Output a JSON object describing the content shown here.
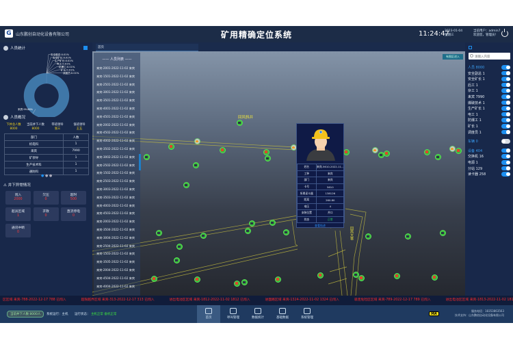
{
  "header": {
    "company": "山东鹏创自动化设备有限公司",
    "title": "矿用精确定位系统",
    "time": "11:24:47",
    "date": "2023-01-04",
    "weekday": "星期三",
    "user": "当前用户：admin7",
    "welcome": "欢迎您，管理员！"
  },
  "left": {
    "stats_title": "人员统计",
    "pie": {
      "labels": [
        "安全副总:0.01%",
        "安全矿长:0.01%",
        "生产矿长:0.01%",
        "电工:0.01%",
        "防爆工:0.01%",
        "矿长:0.01%",
        "调度员:0.01%",
        "来宾:99.88%"
      ],
      "values": [
        0.01,
        0.01,
        0.01,
        0.01,
        0.01,
        0.01,
        0.01,
        99.88
      ],
      "color": "#3f77a8"
    },
    "overview_title": "人员概况",
    "overview": [
      {
        "label": "下井总人数",
        "value": "8000"
      },
      {
        "label": "当前井下人数",
        "value": "8000"
      },
      {
        "label": "带班领导",
        "value": "张三"
      },
      {
        "label": "值班领导",
        "value": "王五"
      }
    ],
    "dept_headers": [
      "部门",
      "人数"
    ],
    "depts": [
      [
        "机电科",
        "1"
      ],
      [
        "来宾",
        "7990"
      ],
      [
        "矿领导",
        "1"
      ],
      [
        "生产技术科",
        "1"
      ],
      [
        "通防科",
        "1"
      ]
    ],
    "alarm_title": "井下异常情况",
    "alarms": [
      {
        "label": "闯入",
        "value": "2000"
      },
      {
        "label": "欠压",
        "value": "0"
      },
      {
        "label": "超时",
        "value": "500"
      },
      {
        "label": "超员区域",
        "value": "1"
      },
      {
        "label": "求救",
        "value": "0"
      },
      {
        "label": "直流停电",
        "value": "0"
      },
      {
        "label": "通讯中断",
        "value": "0"
      }
    ]
  },
  "tab": "首页",
  "map": {
    "button": "有限区进入",
    "list_title": "人员列表",
    "list": [
      "来宾-2001-2022-11-02 来宾",
      "来宾-1501-2022-11-02 来宾",
      "来宾-2501-2022-11-02 来宾",
      "来宾-3001-2022-11-02 来宾",
      "来宾-3501-2022-11-02 来宾",
      "来宾-4001-2022-11-02 来宾",
      "来宾-4501-2022-11-02 来宾",
      "来宾-2002-2022-11-02 来宾",
      "来宾-4502-2022-11-02 来宾",
      "来宾-4002-2022-11-02 来宾",
      "来宾-3502-2022-11-02 来宾",
      "来宾-3002-2022-11-02 来宾",
      "来宾-2502-2022-11-02 来宾",
      "来宾-1502-2022-11-02 来宾",
      "来宾-2503-2022-11-02 来宾",
      "来宾-3003-2022-11-02 来宾",
      "来宾-3503-2022-11-02 来宾",
      "来宾-4003-2022-11-02 来宾",
      "来宾-4503-2022-11-02 来宾",
      "来宾-2003-2022-11-02 来宾",
      "来宾-3504-2022-11-02 来宾",
      "来宾-3004-2022-11-02 来宾",
      "来宾-2504-2022-11-02 来宾",
      "来宾-1503-2022-11-02 来宾",
      "来宾-3505-2022-11-02 来宾",
      "来宾-2004-2022-11-02 来宾",
      "来宾-4504-2022-11-02 来宾",
      "来宾-4004-2022-11-02 来宾"
    ],
    "labels": {
      "tunnel1": "回风斜井",
      "tunnel2": "回风大巷"
    },
    "tunnel_color": "#c8c040",
    "popup": {
      "rows": [
        [
          "姓名",
          "来宾-5610-2022-11..."
        ],
        [
          "工种",
          "来宾"
        ],
        [
          "部门",
          "来宾"
        ],
        [
          "卡号",
          "5610"
        ],
        [
          "所属读卡器",
          "138126"
        ],
        [
          "距离",
          "260.80"
        ],
        [
          "电压",
          "4"
        ],
        [
          "安装位置",
          "井口"
        ],
        [
          "状态",
          "正常"
        ]
      ],
      "footer": "查看轨迹"
    }
  },
  "right": {
    "search_placeholder": "请输入内容",
    "groups": [
      {
        "title": "人员 8000",
        "on": true,
        "items": [
          {
            "label": "安全副总  1",
            "on": true
          },
          {
            "label": "安全矿长  1",
            "on": true
          },
          {
            "label": "后工  1",
            "on": true
          },
          {
            "label": "杂工  1",
            "on": true
          },
          {
            "label": "来宾  7990",
            "on": true
          },
          {
            "label": "爆破技术  1",
            "on": true
          },
          {
            "label": "生产矿长  1",
            "on": true
          },
          {
            "label": "电工  1",
            "on": true
          },
          {
            "label": "防爆工  1",
            "on": true
          },
          {
            "label": "矿长  1",
            "on": true
          },
          {
            "label": "调度员  1",
            "on": true
          }
        ]
      },
      {
        "title": "车辆 0",
        "on": false,
        "items": []
      },
      {
        "title": "设备 404",
        "on": true,
        "items": [
          {
            "label": "交换机  16",
            "on": true
          },
          {
            "label": "电源  1",
            "on": true
          },
          {
            "label": "分站  129",
            "on": true
          },
          {
            "label": "读卡器  258",
            "on": true
          }
        ]
      }
    ]
  },
  "ticker": [
    "区区域 来宾-788-2022-12-17 788 已闯入",
    "超限越界区域 来宾-313-2022-12-17 313 已闯入",
    "进出电池区区域 来宾-1812-2022-11-02 1812 已闯入",
    "进面路区域 来宾-1324-2022-11-02 1324 已闯入",
    "吸连危险区区域 来宾-789-2022-12-17 789 已闯入",
    "进出电池区区域 来宾-1813-2022-11-02 1813 已闯入"
  ],
  "footer": {
    "badge": "当前井下人数 8000人",
    "system_label": "系统运行：",
    "system_value": "主机",
    "status_label": "运行状态：",
    "status_value": "主机正常 备机正常",
    "nav": [
      "首页",
      "呼叫管理",
      "数据统计",
      "基础数据",
      "系统管理"
    ],
    "active_nav": 0,
    "ma": "MA",
    "phone": "服务电话：18353863563",
    "support": "技术支持：山东鹏创自动化设备有限公司"
  }
}
